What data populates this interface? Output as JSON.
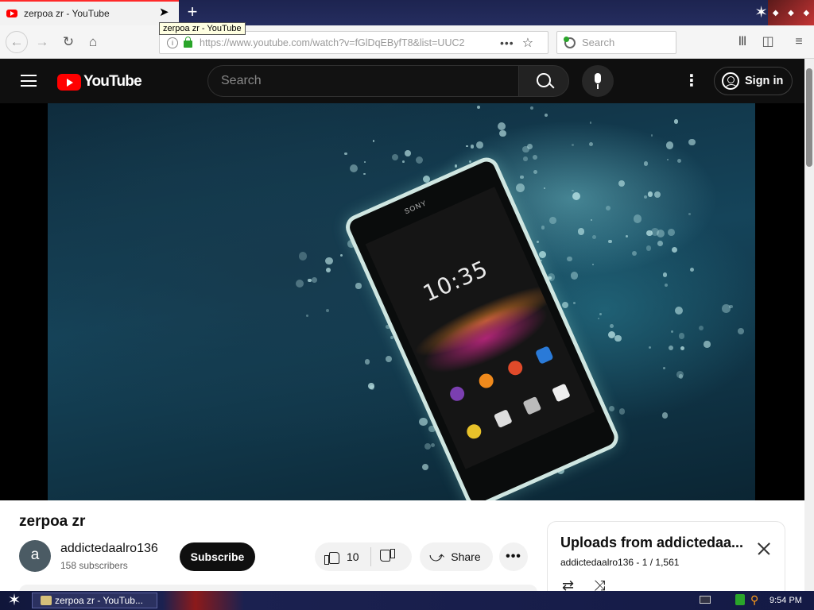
{
  "browser": {
    "tab_title": "zerpoa zr - YouTube",
    "tooltip": "zerpoa zr - YouTube",
    "new_tab_symbol": "+",
    "url": "https://www.youtube.com/watch?v=fGlDqEByfT8&list=UUC2",
    "search_placeholder": "Search",
    "page_actions_symbol": "•••",
    "bookmark_symbol": "☆"
  },
  "youtube": {
    "logo_text": "YouTube",
    "search_placeholder": "Search",
    "more_symbol": "⋮",
    "signin_label": "Sign in"
  },
  "video": {
    "title": "zerpoa zr",
    "phone_clock": "10:35",
    "phone_brand": "SONY",
    "channel": {
      "avatar_letter": "a",
      "name": "addictedaalro136",
      "subscribers": "158 subscribers"
    },
    "subscribe_label": "Subscribe",
    "like_count": "10",
    "share_label": "Share",
    "more_symbol": "•••"
  },
  "playlist": {
    "title": "Uploads from addictedaa...",
    "meta": "addictedaalro136 - 1 / 1,561"
  },
  "taskbar": {
    "window_label": "zerpoa zr - YouTub...",
    "clock": "9:54 PM"
  },
  "colors": {
    "youtube_red": "#ff0000",
    "yt_header_bg": "#0f0f0f",
    "taskbar_bg": "#141a45"
  },
  "icons": [
    "youtube-favicon",
    "cursor-icon",
    "back-icon",
    "forward-icon",
    "reload-icon",
    "home-icon",
    "info-icon",
    "lock-icon",
    "library-icon",
    "sidebar-icon",
    "menu-icon",
    "hamburger-icon",
    "search-icon",
    "mic-icon",
    "account-icon",
    "like-icon",
    "dislike-icon",
    "share-icon",
    "close-icon",
    "loop-icon",
    "shuffle-icon",
    "start-icon"
  ]
}
